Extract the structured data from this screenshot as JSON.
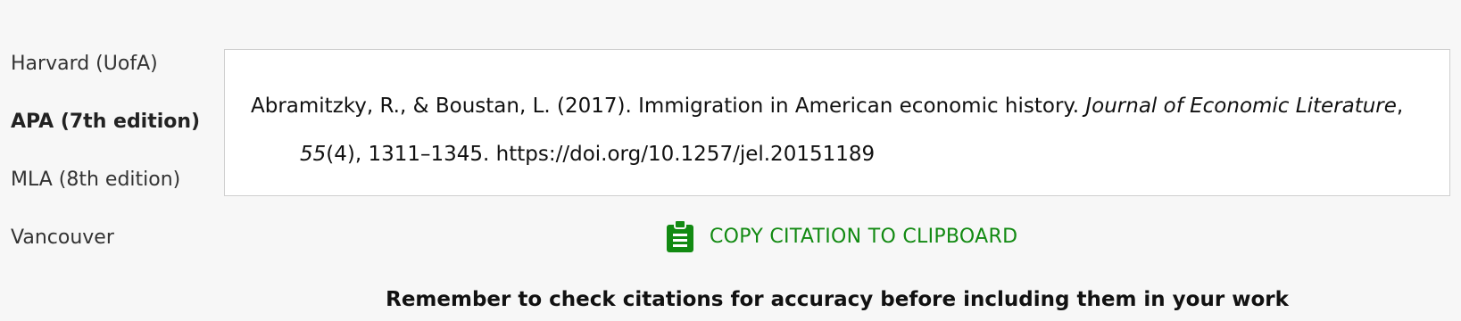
{
  "citation_styles": [
    {
      "label": "Harvard (UofA)",
      "active": false
    },
    {
      "label": "APA (7th edition)",
      "active": true
    },
    {
      "label": "MLA (8th edition)",
      "active": false
    },
    {
      "label": "Vancouver",
      "active": false
    }
  ],
  "citation": {
    "authors_year_title": "Abramitzky, R., & Boustan, L. (2017). Immigration in American economic history. ",
    "journal": "Journal of Economic Literature",
    "sep1": ", ",
    "volume": "55",
    "issue": "(4), ",
    "pages_doi": "1311–1345. https://doi.org/10.1257/jel.20151189"
  },
  "copy_button": {
    "label": "COPY CITATION TO CLIPBOARD",
    "icon": "clipboard-icon",
    "color": "#128a12"
  },
  "reminder": "Remember to check citations for accuracy before including them in your work"
}
